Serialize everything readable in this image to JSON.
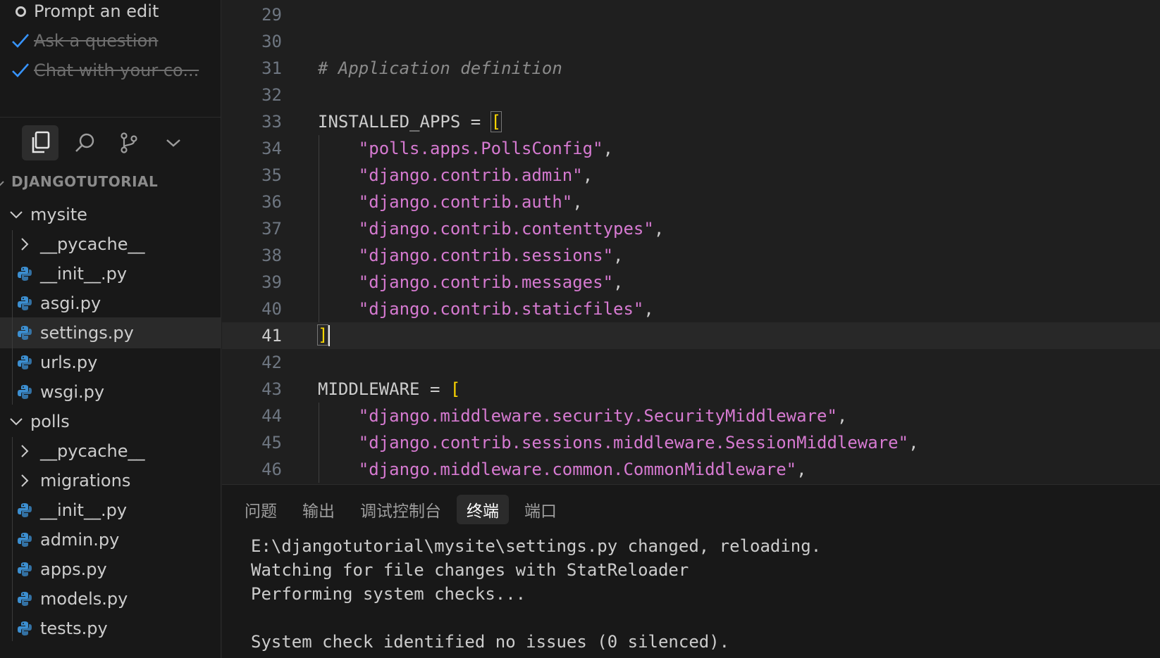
{
  "tasks": [
    {
      "label": "Prompt an edit",
      "done": false
    },
    {
      "label": "Ask a question",
      "done": true
    },
    {
      "label": "Chat with your co...",
      "done": true
    }
  ],
  "activity_icons": [
    "explorer-icon",
    "search-icon",
    "source-control-icon",
    "chevron-down-icon"
  ],
  "explorer": {
    "title": "DJANGOTUTORIAL",
    "tree": [
      {
        "label": "mysite",
        "kind": "folder-open",
        "depth": 0
      },
      {
        "label": "__pycache__",
        "kind": "folder-closed",
        "depth": 1
      },
      {
        "label": "__init__.py",
        "kind": "python-file",
        "depth": 1
      },
      {
        "label": "asgi.py",
        "kind": "python-file",
        "depth": 1
      },
      {
        "label": "settings.py",
        "kind": "python-file",
        "depth": 1,
        "selected": true
      },
      {
        "label": "urls.py",
        "kind": "python-file",
        "depth": 1
      },
      {
        "label": "wsgi.py",
        "kind": "python-file",
        "depth": 1
      },
      {
        "label": "polls",
        "kind": "folder-open",
        "depth": 0
      },
      {
        "label": "__pycache__",
        "kind": "folder-closed",
        "depth": 1
      },
      {
        "label": "migrations",
        "kind": "folder-closed",
        "depth": 1
      },
      {
        "label": "__init__.py",
        "kind": "python-file",
        "depth": 1
      },
      {
        "label": "admin.py",
        "kind": "python-file",
        "depth": 1
      },
      {
        "label": "apps.py",
        "kind": "python-file",
        "depth": 1
      },
      {
        "label": "models.py",
        "kind": "python-file",
        "depth": 1
      },
      {
        "label": "tests.py",
        "kind": "python-file",
        "depth": 1
      }
    ]
  },
  "editor": {
    "current_line": 41,
    "lines": [
      {
        "n": "29",
        "parts": []
      },
      {
        "n": "30",
        "parts": []
      },
      {
        "n": "31",
        "parts": [
          {
            "t": "# Application definition",
            "c": "comment"
          }
        ]
      },
      {
        "n": "32",
        "parts": []
      },
      {
        "n": "33",
        "parts": [
          {
            "t": "INSTALLED_APPS = ",
            "c": "plain"
          },
          {
            "t": "[",
            "c": "bracket"
          }
        ]
      },
      {
        "n": "34",
        "parts": [
          {
            "t": "    ",
            "c": "plain"
          },
          {
            "t": "\"polls.apps.PollsConfig\"",
            "c": "str"
          },
          {
            "t": ",",
            "c": "plain"
          }
        ]
      },
      {
        "n": "35",
        "parts": [
          {
            "t": "    ",
            "c": "plain"
          },
          {
            "t": "\"django.contrib.admin\"",
            "c": "str"
          },
          {
            "t": ",",
            "c": "plain"
          }
        ]
      },
      {
        "n": "36",
        "parts": [
          {
            "t": "    ",
            "c": "plain"
          },
          {
            "t": "\"django.contrib.auth\"",
            "c": "str"
          },
          {
            "t": ",",
            "c": "plain"
          }
        ]
      },
      {
        "n": "37",
        "parts": [
          {
            "t": "    ",
            "c": "plain"
          },
          {
            "t": "\"django.contrib.contenttypes\"",
            "c": "str"
          },
          {
            "t": ",",
            "c": "plain"
          }
        ]
      },
      {
        "n": "38",
        "parts": [
          {
            "t": "    ",
            "c": "plain"
          },
          {
            "t": "\"django.contrib.sessions\"",
            "c": "str"
          },
          {
            "t": ",",
            "c": "plain"
          }
        ]
      },
      {
        "n": "39",
        "parts": [
          {
            "t": "    ",
            "c": "plain"
          },
          {
            "t": "\"django.contrib.messages\"",
            "c": "str"
          },
          {
            "t": ",",
            "c": "plain"
          }
        ]
      },
      {
        "n": "40",
        "parts": [
          {
            "t": "    ",
            "c": "plain"
          },
          {
            "t": "\"django.contrib.staticfiles\"",
            "c": "str"
          },
          {
            "t": ",",
            "c": "plain"
          }
        ]
      },
      {
        "n": "41",
        "parts": [
          {
            "t": "]",
            "c": "bracket"
          }
        ]
      },
      {
        "n": "42",
        "parts": []
      },
      {
        "n": "43",
        "parts": [
          {
            "t": "MIDDLEWARE = ",
            "c": "plain"
          },
          {
            "t": "[",
            "c": "bracket"
          }
        ]
      },
      {
        "n": "44",
        "parts": [
          {
            "t": "    ",
            "c": "plain"
          },
          {
            "t": "\"django.middleware.security.SecurityMiddleware\"",
            "c": "str"
          },
          {
            "t": ",",
            "c": "plain"
          }
        ]
      },
      {
        "n": "45",
        "parts": [
          {
            "t": "    ",
            "c": "plain"
          },
          {
            "t": "\"django.contrib.sessions.middleware.SessionMiddleware\"",
            "c": "str"
          },
          {
            "t": ",",
            "c": "plain"
          }
        ]
      },
      {
        "n": "46",
        "parts": [
          {
            "t": "    ",
            "c": "plain"
          },
          {
            "t": "\"django.middleware.common.CommonMiddleware\"",
            "c": "str"
          },
          {
            "t": ",",
            "c": "plain"
          }
        ]
      }
    ]
  },
  "panel": {
    "tabs": [
      {
        "label": "问题",
        "active": false
      },
      {
        "label": "输出",
        "active": false
      },
      {
        "label": "调试控制台",
        "active": false
      },
      {
        "label": "终端",
        "active": true
      },
      {
        "label": "端口",
        "active": false
      }
    ],
    "terminal_lines": [
      "E:\\djangotutorial\\mysite\\settings.py changed, reloading.",
      "Watching for file changes with StatReloader",
      "Performing system checks...",
      "",
      "System check identified no issues (0 silenced)."
    ]
  },
  "colors": {
    "string": "#d67ad1",
    "bracket": "#ffd700",
    "check": "#3794ff",
    "python_icon": "#3c8fd1"
  }
}
